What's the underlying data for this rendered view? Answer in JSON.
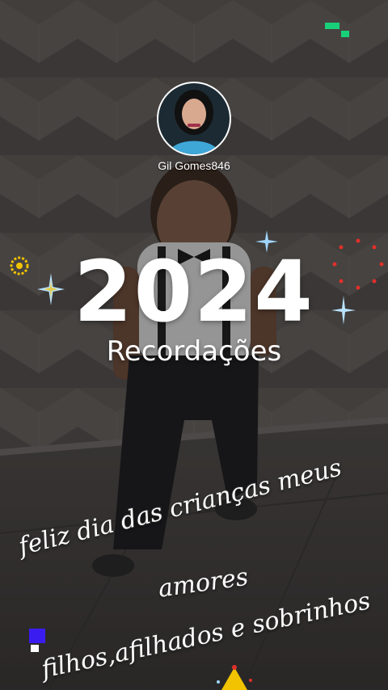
{
  "profile": {
    "username": "Gil Gomes846"
  },
  "memories": {
    "year": "2024",
    "title": "Recordações"
  },
  "caption": {
    "line1": "feliz dia das crianças meus",
    "line2": "amores",
    "line3": "filhos,afilhados e sobrinhos"
  },
  "colors": {
    "accent_green": "#19d07a",
    "accent_blue": "#3b1cf0",
    "sparkle_blue": "#9fd6ff",
    "sparkle_gold": "#f2c300",
    "firework_red": "#e0302a"
  }
}
